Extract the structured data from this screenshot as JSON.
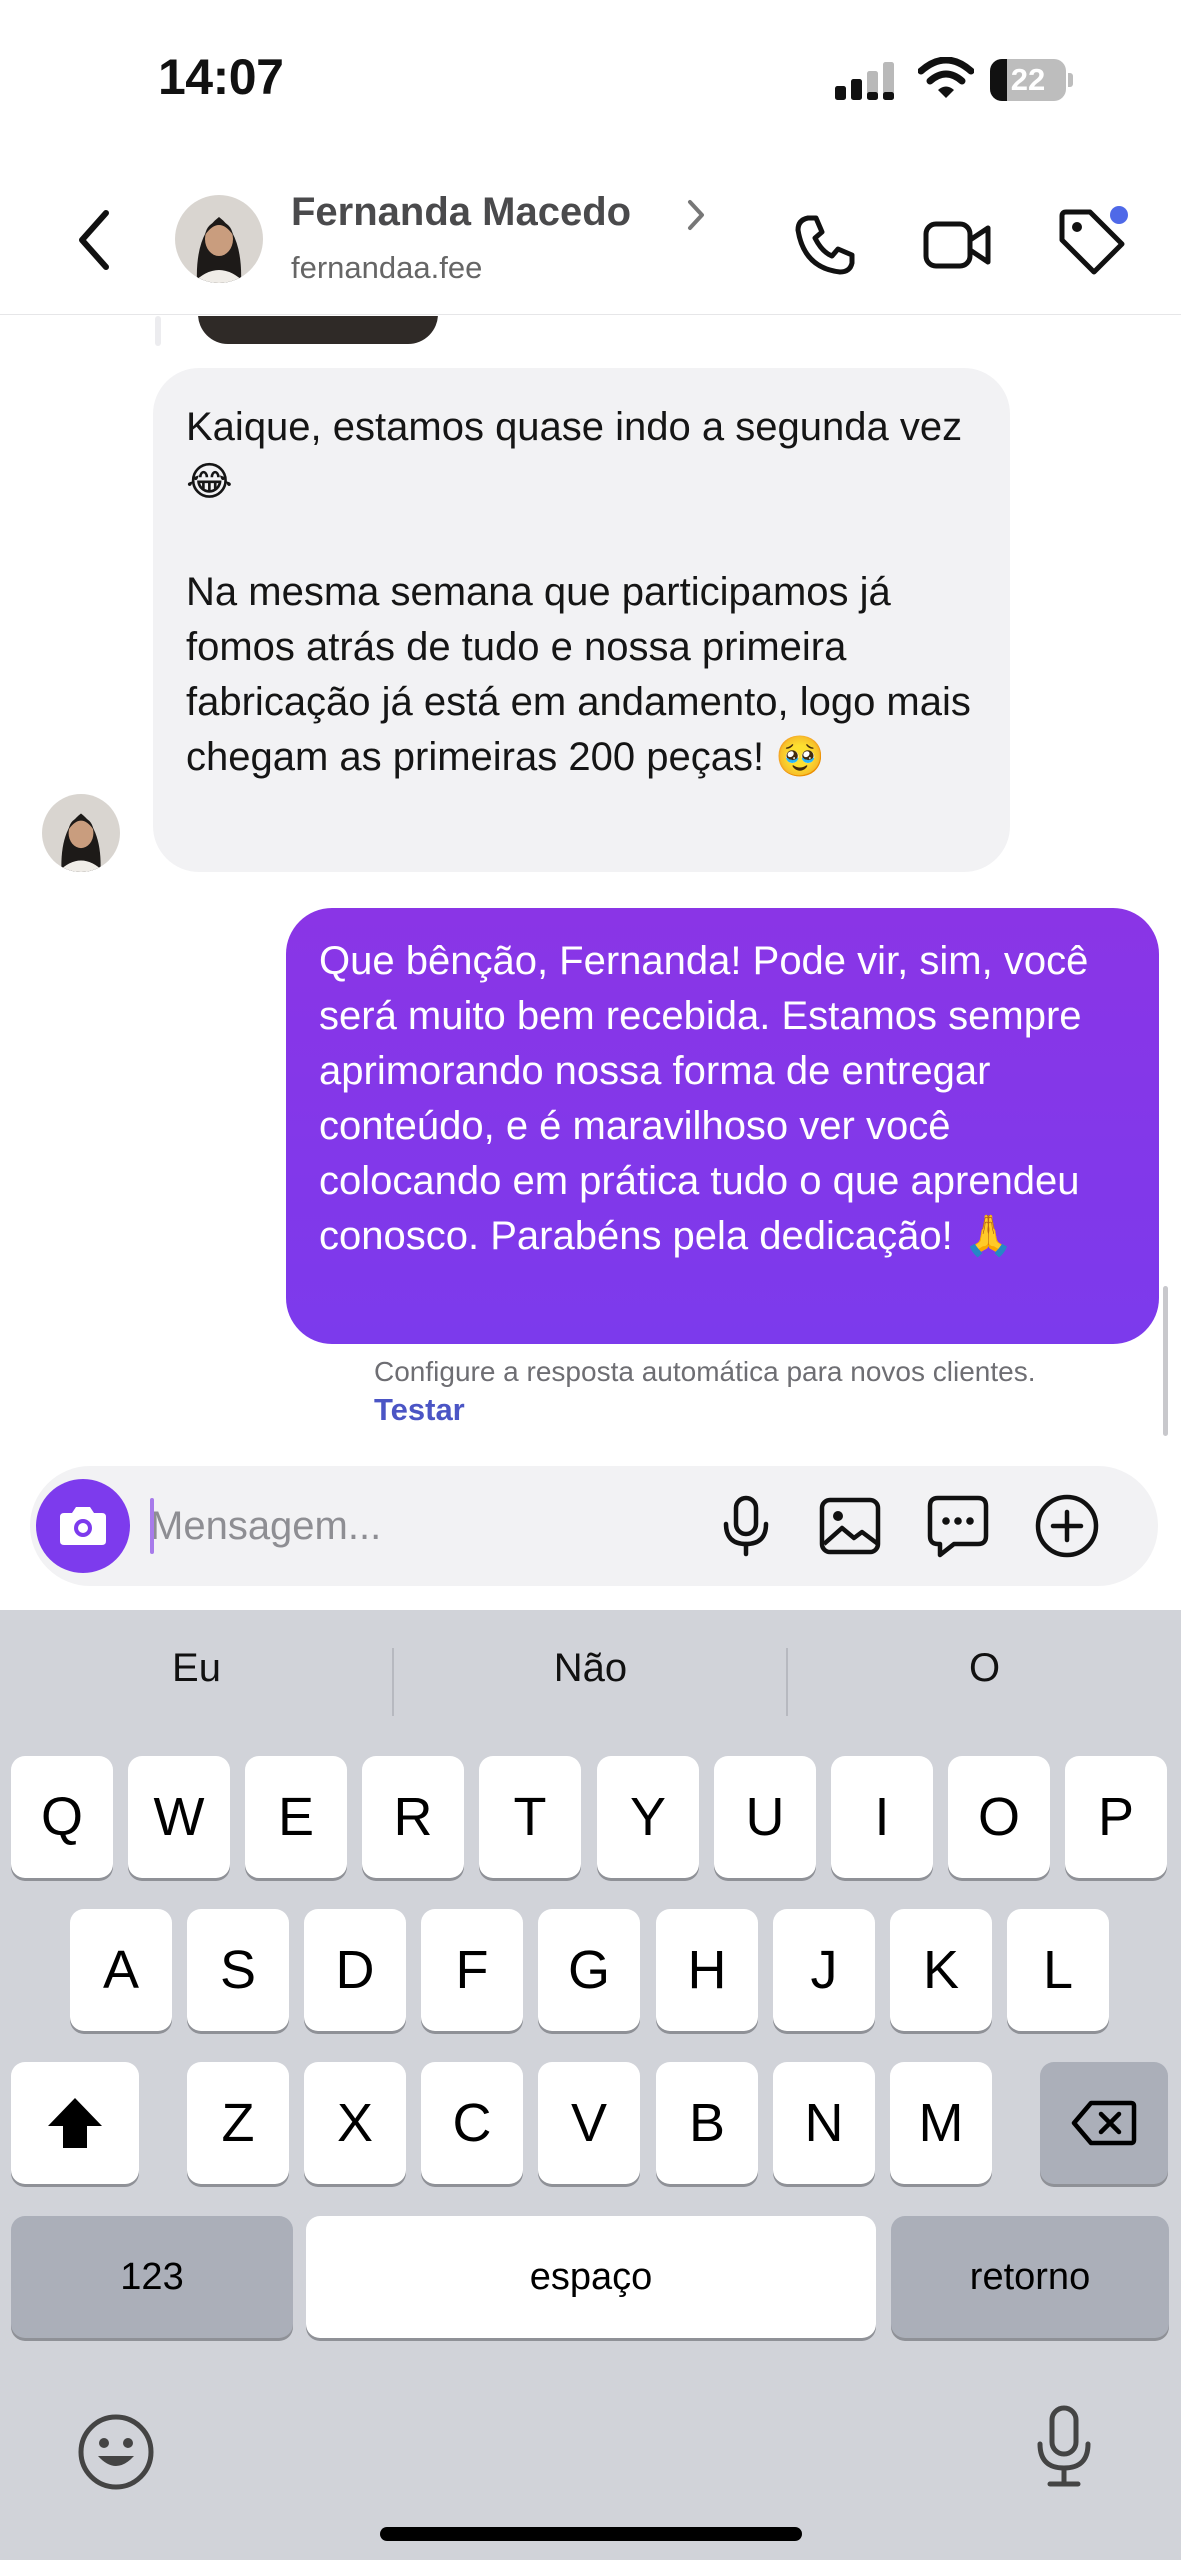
{
  "status_bar": {
    "time": "14:07",
    "battery_level": "22",
    "battery_fraction": 0.22,
    "icons": [
      "signal-icon",
      "wifi-icon",
      "battery-icon"
    ]
  },
  "header": {
    "contact_name": "Fernanda Macedo",
    "username": "fernandaa.fee",
    "icons": [
      "back-icon",
      "phone-icon",
      "video-icon",
      "tag-icon"
    ],
    "tag_dot_color": "#4f69e8"
  },
  "messages": [
    {
      "direction": "incoming",
      "text": "Kaique, estamos quase indo a segunda vez 😂\n\nNa mesma semana que participamos já fomos atrás de tudo e nossa primeira fabricação já está em andamento, logo mais chegam as primeiras 200 peças! 🥹"
    },
    {
      "direction": "outgoing",
      "text": "Que bênção, Fernanda! Pode vir, sim, você será muito bem recebida. Estamos sempre aprimorando nossa forma de entregar conteúdo, e é maravilhoso ver você colocando em prática tudo o que aprendeu conosco. Parabéns pela dedicação! 🙏"
    }
  ],
  "auto_reply": {
    "hint": "Configure a resposta automática para novos clientes.",
    "action": "Testar"
  },
  "composer": {
    "placeholder": "Mensagem...",
    "value": "",
    "icons": [
      "camera-icon",
      "microphone-icon",
      "gallery-icon",
      "quick-reply-icon",
      "plus-icon"
    ]
  },
  "keyboard": {
    "suggestions": [
      "Eu",
      "Não",
      "O"
    ],
    "row1": [
      "Q",
      "W",
      "E",
      "R",
      "T",
      "Y",
      "U",
      "I",
      "O",
      "P"
    ],
    "row2": [
      "A",
      "S",
      "D",
      "F",
      "G",
      "H",
      "J",
      "K",
      "L"
    ],
    "row3": [
      "Z",
      "X",
      "C",
      "V",
      "B",
      "N",
      "M"
    ],
    "numbers_label": "123",
    "space_label": "espaço",
    "return_label": "retorno",
    "icons": [
      "shift-icon",
      "backspace-icon",
      "emoji-icon",
      "dictation-icon"
    ]
  },
  "colors": {
    "accent": "#7d3bed",
    "outgoing_bubble": "#8a35e6",
    "incoming_bubble": "#f2f2f4",
    "link": "#4b55c5"
  }
}
